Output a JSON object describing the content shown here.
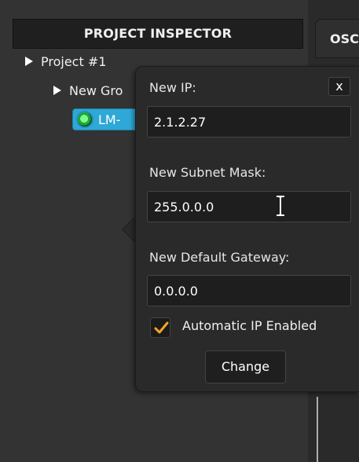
{
  "inspector": {
    "title": "PROJECT INSPECTOR",
    "tree": {
      "project_label": "Project #1",
      "group_label": "New Gro",
      "device_label": "LM-"
    }
  },
  "right_panel": {
    "tab_label": "OSC"
  },
  "popover": {
    "close_label": "x",
    "new_ip": {
      "label": "New IP:",
      "value": "2.1.2.27"
    },
    "new_subnet": {
      "label": "New Subnet Mask:",
      "value": "255.0.0.0"
    },
    "new_gateway": {
      "label": "New Default Gateway:",
      "value": "0.0.0.0"
    },
    "automatic_ip": {
      "label": "Automatic IP Enabled",
      "checked": true
    },
    "change_button_label": "Change"
  },
  "colors": {
    "accent_blue": "#2ea8d6",
    "check_orange": "#f2a62b",
    "panel_bg": "#333333",
    "popover_bg": "#2a2a2a"
  },
  "icons": {
    "expand_arrow": "triangle-right-icon",
    "device_status": "gear-icon",
    "text_cursor": "ibeam-cursor-icon",
    "checkmark": "checkmark-icon"
  }
}
